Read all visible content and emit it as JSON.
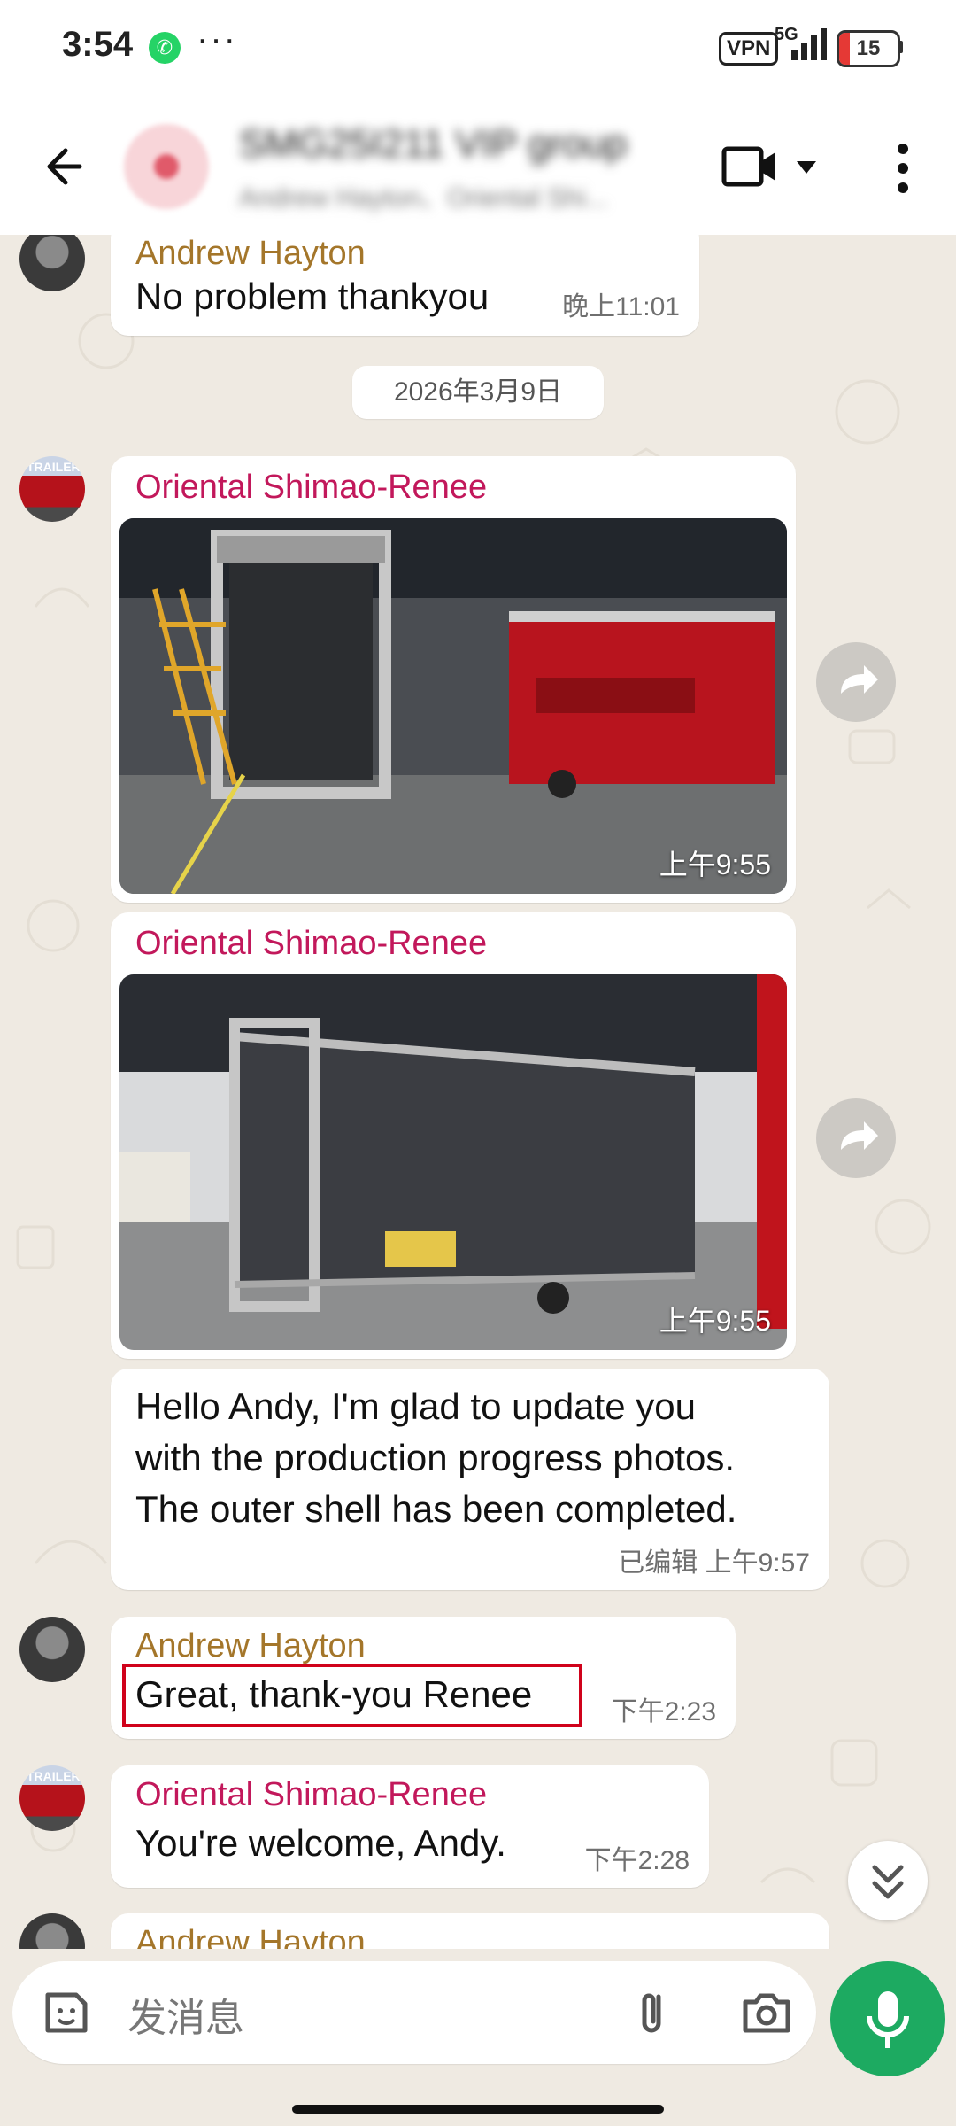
{
  "status_bar": {
    "time": "3:54",
    "dots": "···",
    "vpn": "VPN",
    "network": "5G",
    "battery": "15"
  },
  "header": {
    "title": "SMG25I211 VIP group",
    "subtitle": "Andrew Hayton、Oriental Shi..."
  },
  "messages": {
    "m1": {
      "sender": "Andrew Hayton",
      "text": "No problem thankyou",
      "time": "晚上11:01"
    },
    "date_divider": "2026年3月9日",
    "m2": {
      "sender": "Oriental Shimao-Renee",
      "time": "上午9:55"
    },
    "m3": {
      "sender": "Oriental Shimao-Renee",
      "time": "上午9:55"
    },
    "m4": {
      "lines": [
        "Hello Andy, I'm glad to update you",
        "with the production progress photos.",
        "The outer shell has been completed."
      ],
      "time": "已编辑 上午9:57"
    },
    "m5": {
      "sender": "Andrew Hayton",
      "text": "Great, thank-you Renee",
      "time": "下午2:23"
    },
    "m6": {
      "sender": "Oriental Shimao-Renee",
      "text": "You're welcome, Andy.",
      "time": "下午2:28"
    },
    "m7": {
      "sender": "Andrew Hayton"
    }
  },
  "avatar_badge": "TRAILER",
  "composer": {
    "placeholder": "发消息"
  },
  "colors": {
    "accent": "#1daa61",
    "andrew_name": "#a4762a",
    "renee_name": "#c2185b",
    "chat_bg": "#efeae2",
    "highlight": "#d0021b"
  },
  "icons": [
    "back-arrow-icon",
    "video-call-icon",
    "chevron-down-icon",
    "more-vert-icon",
    "forward-icon",
    "double-chevron-down-icon",
    "sticker-icon",
    "paperclip-icon",
    "camera-icon",
    "microphone-icon",
    "whatsapp-icon",
    "signal-icon",
    "battery-icon"
  ]
}
